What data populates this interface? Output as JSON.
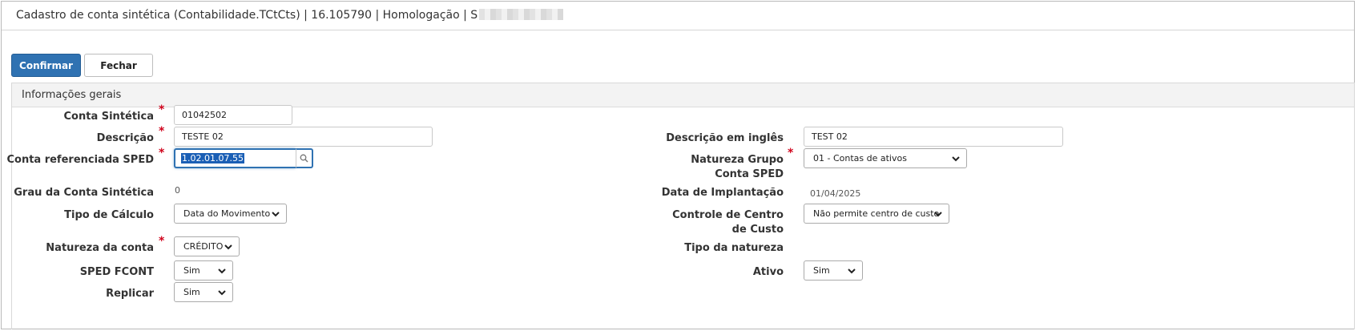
{
  "window": {
    "title": "Cadastro de conta sintética (Contabilidade.TCtCts) | 16.105790 | Homologação | S"
  },
  "toolbar": {
    "confirm_label": "Confirmar",
    "close_label": "Fechar"
  },
  "section": {
    "title": "Informações gerais"
  },
  "form": {
    "conta_sintetica": {
      "label": "Conta Sintética",
      "value": "01042502"
    },
    "descricao": {
      "label": "Descrição",
      "value": "TESTE 02"
    },
    "descricao_ingles": {
      "label": "Descrição em inglês",
      "value": "TEST 02"
    },
    "conta_referenciada": {
      "label": "Conta referenciada SPED",
      "value": "1.02.01.07.55"
    },
    "natureza_grupo": {
      "label": "Natureza Grupo Conta SPED",
      "value": "01 - Contas de ativos"
    },
    "grau": {
      "label": "Grau da Conta Sintética",
      "value": "0"
    },
    "data_implantacao": {
      "label": "Data de Implantação",
      "value": "01/04/2025"
    },
    "tipo_calculo": {
      "label": "Tipo de Cálculo",
      "value": "Data do Movimento"
    },
    "controle_centro_custo": {
      "label": "Controle de Centro de Custo",
      "value": "Não permite centro de custo"
    },
    "natureza_conta": {
      "label": "Natureza da conta",
      "value": "CRÉDITO"
    },
    "tipo_natureza": {
      "label": "Tipo da natureza"
    },
    "sped_fcont": {
      "label": "SPED FCONT",
      "value": "Sim"
    },
    "ativo": {
      "label": "Ativo",
      "value": "Sim"
    },
    "replicar": {
      "label": "Replicar",
      "value": "Sim"
    },
    "required_mark": "*"
  },
  "icons": {
    "lookup": "magnifier-icon",
    "dropdown": "chevron-down-icon"
  },
  "colors": {
    "primary": "#2f72b2",
    "required": "#d0021b",
    "selection": "#1b5fb5"
  }
}
